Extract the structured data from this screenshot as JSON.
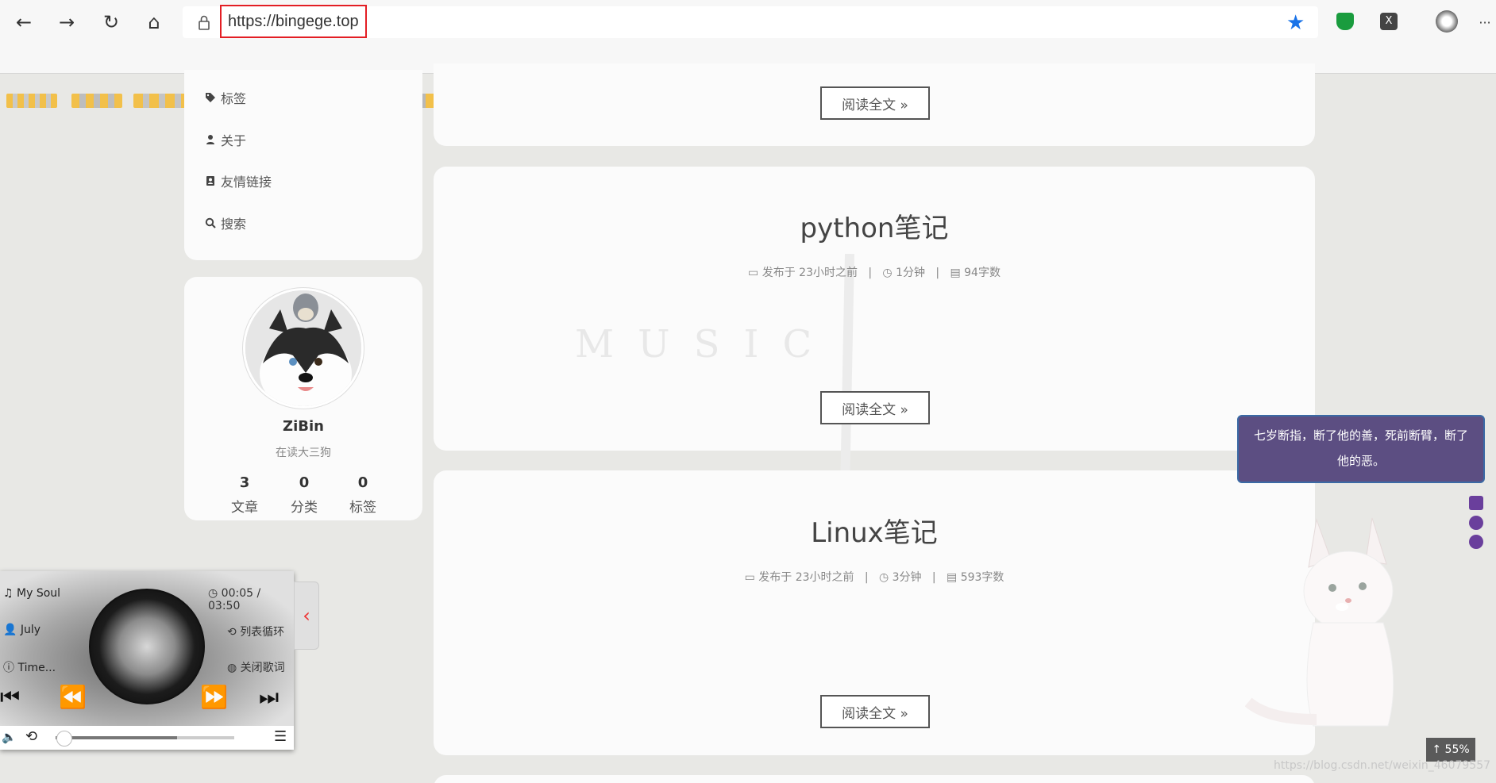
{
  "browser": {
    "url": "https://bingege.top",
    "nav": {
      "back": "←",
      "forward": "→",
      "reload": "↻",
      "home": "⌂"
    },
    "more": "···"
  },
  "sidebar": {
    "menu": [
      {
        "label": "标签",
        "icon": "tag-icon"
      },
      {
        "label": "关于",
        "icon": "user-icon"
      },
      {
        "label": "友情链接",
        "icon": "address-book-icon"
      },
      {
        "label": "搜索",
        "icon": "search-icon"
      }
    ],
    "profile": {
      "name": "ZiBin",
      "bio": "在读大三狗",
      "stats": [
        {
          "count": "3",
          "label": "文章"
        },
        {
          "count": "0",
          "label": "分类"
        },
        {
          "count": "0",
          "label": "标签"
        }
      ]
    }
  },
  "posts": [
    {
      "read_more": "阅读全文 »"
    },
    {
      "title": "python笔记",
      "published": "发布于 23小时之前",
      "read_time": "1分钟",
      "words": "94字数",
      "read_more": "阅读全文 »"
    },
    {
      "title": "Linux笔记",
      "published": "发布于 23小时之前",
      "read_time": "3分钟",
      "words": "593字数",
      "read_more": "阅读全文 »"
    }
  ],
  "player": {
    "song": "My Soul",
    "artist": "July",
    "album": "Time...",
    "time": "00:05 / 03:50",
    "mode": "列表循环",
    "lyrics": "关闭歌词",
    "progress": 0.02,
    "volume_fill": 0.68
  },
  "waifu": {
    "message": "七岁断指，断了他的善，死前断臂，断了他的恶。"
  },
  "back_to_top": "55%",
  "watermark": "https://blog.csdn.net/weixin_46079557",
  "colors": {
    "accent": "#5c4e82",
    "star": "#1a73e8",
    "url_box": "#e31e24"
  }
}
